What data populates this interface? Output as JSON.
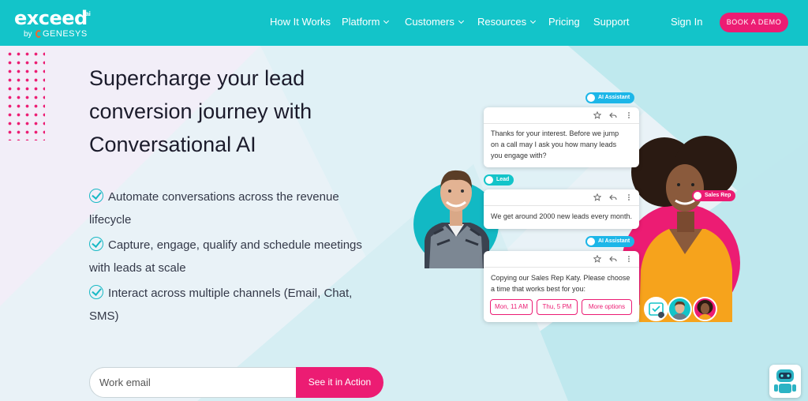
{
  "brand": {
    "wordmark": "exceed",
    "ai_suffix": ".ai",
    "by": "by",
    "parent": "GENESYS"
  },
  "nav": {
    "items": [
      {
        "label": "How It Works"
      },
      {
        "label": "Platform",
        "has_dropdown": true
      },
      {
        "label": "Customers",
        "has_dropdown": true
      },
      {
        "label": "Resources",
        "has_dropdown": true
      },
      {
        "label": "Pricing"
      },
      {
        "label": "Support"
      }
    ],
    "sign_in": "Sign In",
    "cta": "BOOK A DEMO"
  },
  "hero": {
    "title_lines": [
      "Supercharge your lead",
      "conversion journey with",
      "Conversational AI"
    ],
    "bullets": [
      {
        "line1": "Automate conversations across the revenue",
        "line2": "lifecycle"
      },
      {
        "line1": "Capture, engage, qualify and schedule meetings",
        "line2": "with leads at scale"
      },
      {
        "line1": "Interact across multiple channels (Email, Chat,",
        "line2": "SMS)"
      }
    ]
  },
  "form": {
    "email_placeholder": "Work email",
    "submit_label": "See it in Action"
  },
  "chat": {
    "tags": {
      "ai": "AI Assistant",
      "lead": "Lead",
      "rep": "Sales Rep"
    },
    "messages": [
      {
        "lines": [
          "Thanks for your interest. Before we jump",
          "on a call may I ask you how many leads",
          "you engage with?"
        ]
      },
      {
        "lines": [
          "We get around 2000 new leads every month."
        ]
      },
      {
        "lines": [
          "Copying our Sales Rep Katy. Please choose",
          "a time that works best for you:"
        ]
      }
    ],
    "slots": [
      "Mon, 11 AM",
      "Thu, 5 PM",
      "More options"
    ]
  },
  "colors": {
    "teal": "#13c4c9",
    "pink": "#ec1c73",
    "blue_tag": "#1cb6e8"
  },
  "icons": [
    "star-icon",
    "reply-icon",
    "more-vertical-icon",
    "check-circle-icon",
    "calendar-check-icon",
    "chatbot-icon"
  ]
}
